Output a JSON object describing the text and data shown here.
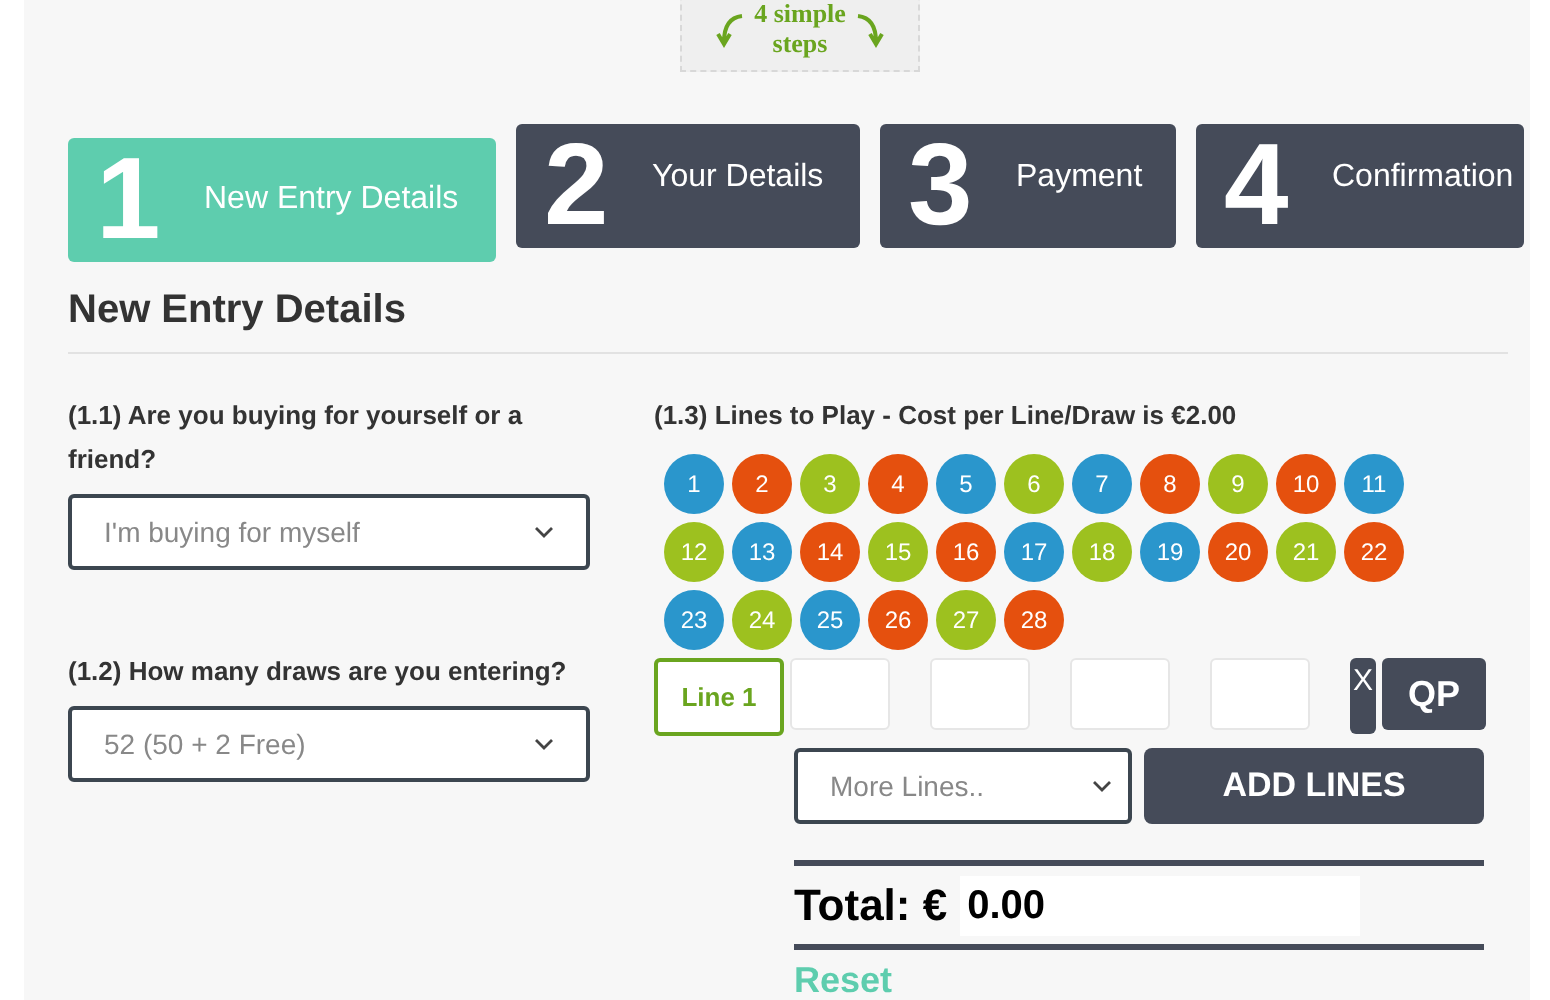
{
  "badge": {
    "lines": [
      "4 simple",
      "steps"
    ]
  },
  "steps": [
    {
      "number": "1",
      "label": "New Entry Details",
      "selected": true
    },
    {
      "number": "2",
      "label": "Your Details",
      "selected": false
    },
    {
      "number": "3",
      "label": "Payment",
      "selected": false
    },
    {
      "number": "4",
      "label": "Confirmation",
      "selected": false
    }
  ],
  "heading": "New Entry Details",
  "questions": [
    {
      "label": "(1.1) Are you buying for yourself or a friend?",
      "value": "I'm buying for myself"
    },
    {
      "label": "(1.2) How many draws are you entering?",
      "value": "52 (50 + 2 Free)"
    }
  ],
  "lines": {
    "label": "(1.3) Lines to Play - Cost per Line/Draw is €2.00",
    "balls": [
      {
        "number": "1",
        "color": "#2a96cc"
      },
      {
        "number": "2",
        "color": "#e5500e"
      },
      {
        "number": "3",
        "color": "#9dc11f"
      },
      {
        "number": "4",
        "color": "#e5500e"
      },
      {
        "number": "5",
        "color": "#2a96cc"
      },
      {
        "number": "6",
        "color": "#9dc11f"
      },
      {
        "number": "7",
        "color": "#2a96cc"
      },
      {
        "number": "8",
        "color": "#e5500e"
      },
      {
        "number": "9",
        "color": "#9dc11f"
      },
      {
        "number": "10",
        "color": "#e5500e"
      },
      {
        "number": "11",
        "color": "#2a96cc"
      },
      {
        "number": "12",
        "color": "#9dc11f"
      },
      {
        "number": "13",
        "color": "#2a96cc"
      },
      {
        "number": "14",
        "color": "#e5500e"
      },
      {
        "number": "15",
        "color": "#9dc11f"
      },
      {
        "number": "16",
        "color": "#e5500e"
      },
      {
        "number": "17",
        "color": "#2a96cc"
      },
      {
        "number": "18",
        "color": "#9dc11f"
      },
      {
        "number": "19",
        "color": "#2a96cc"
      },
      {
        "number": "20",
        "color": "#e5500e"
      },
      {
        "number": "21",
        "color": "#9dc11f"
      },
      {
        "number": "22",
        "color": "#e5500e"
      },
      {
        "number": "23",
        "color": "#2a96cc"
      },
      {
        "number": "24",
        "color": "#9dc11f"
      },
      {
        "number": "25",
        "color": "#2a96cc"
      },
      {
        "number": "26",
        "color": "#e5500e"
      },
      {
        "number": "27",
        "color": "#9dc11f"
      },
      {
        "number": "28",
        "color": "#e5500e"
      }
    ],
    "line_label": "Line 1",
    "clear_button": "X",
    "quick_pick_button": "QP",
    "more_lines": {
      "placeholder": "More Lines.."
    },
    "add_button": "ADD LINES"
  },
  "total": {
    "label": "Total: €",
    "value": "0.00"
  },
  "reset": "Reset"
}
